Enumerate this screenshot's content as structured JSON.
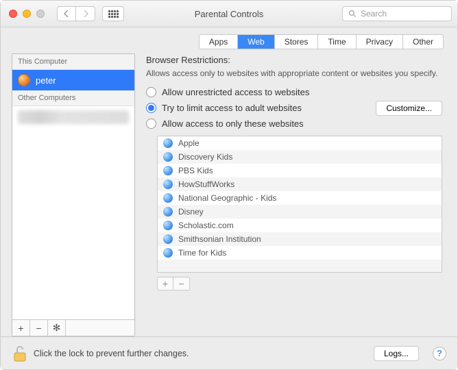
{
  "window": {
    "title": "Parental Controls"
  },
  "search": {
    "placeholder": "Search"
  },
  "tabs": [
    {
      "label": "Apps"
    },
    {
      "label": "Web"
    },
    {
      "label": "Stores"
    },
    {
      "label": "Time"
    },
    {
      "label": "Privacy"
    },
    {
      "label": "Other"
    }
  ],
  "active_tab": 1,
  "sidebar": {
    "headers": {
      "this": "This Computer",
      "other": "Other Computers"
    },
    "users": [
      {
        "name": "peter"
      }
    ]
  },
  "main": {
    "heading": "Browser Restrictions:",
    "subtext": "Allows access only to websites with appropriate content or websites you specify.",
    "options": [
      "Allow unrestricted access to websites",
      "Try to limit access to adult websites",
      "Allow access to only these websites"
    ],
    "selected_option": 1,
    "customize_label": "Customize...",
    "sites": [
      "Apple",
      "Discovery Kids",
      "PBS Kids",
      "HowStuffWorks",
      "National Geographic - Kids",
      "Disney",
      "Scholastic.com",
      "Smithsonian Institution",
      "Time for Kids"
    ]
  },
  "footer": {
    "lock_text": "Click the lock to prevent further changes.",
    "logs_label": "Logs...",
    "help_label": "?"
  }
}
